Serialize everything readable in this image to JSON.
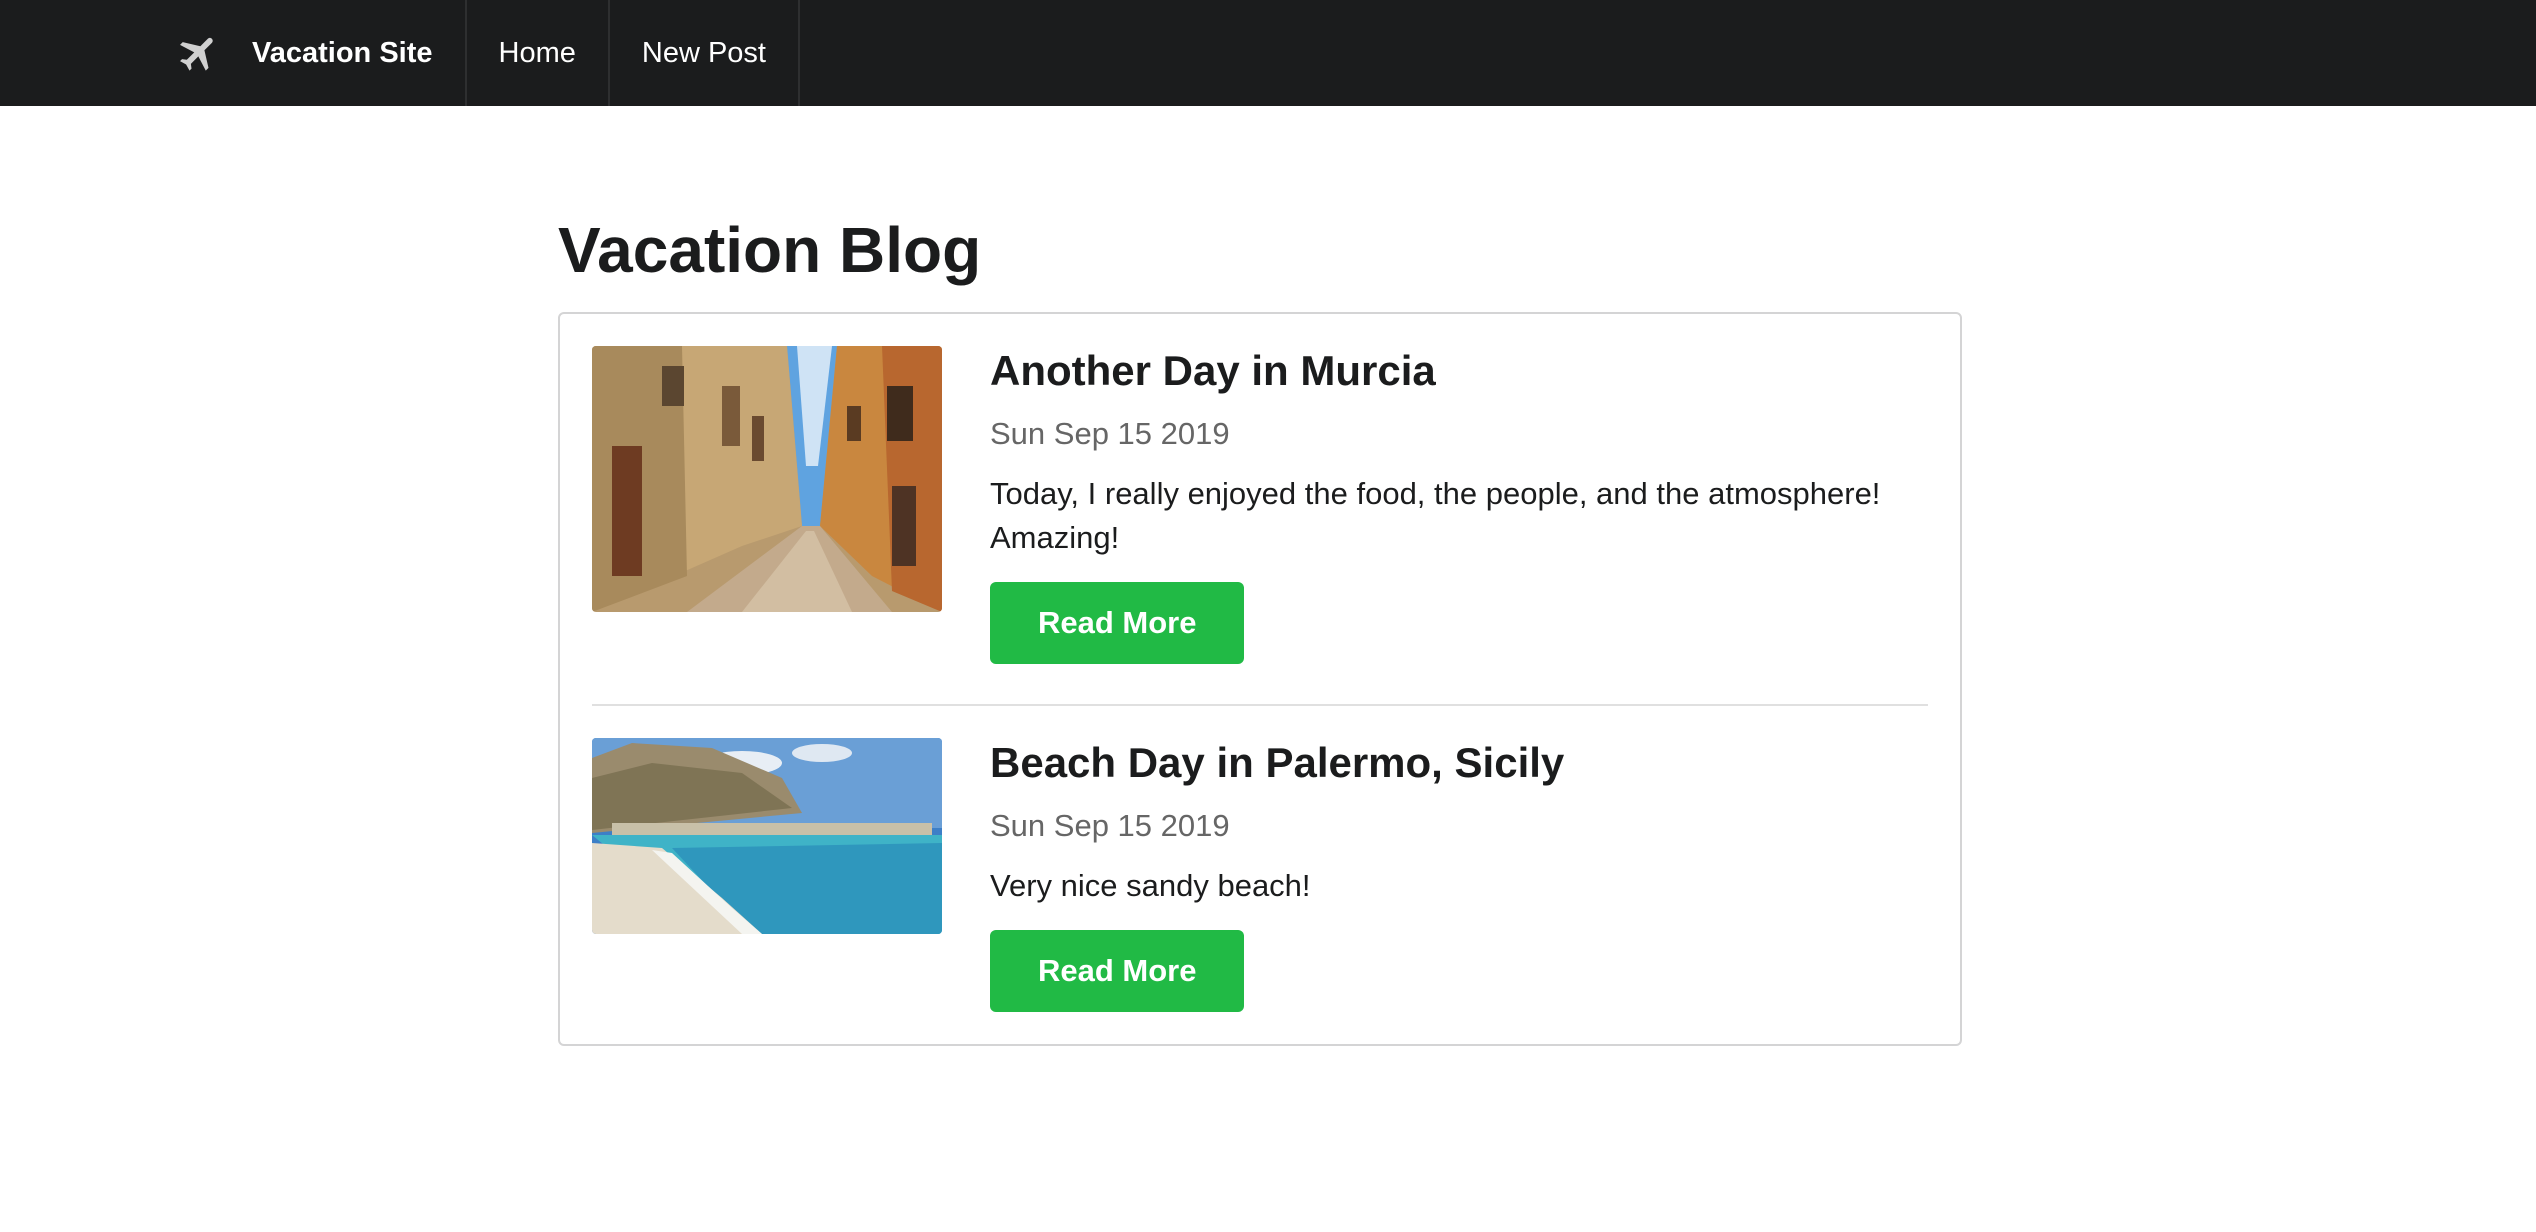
{
  "nav": {
    "brand_icon": "airplane-icon",
    "brand_label": "Vacation Site",
    "items": [
      {
        "label": "Home"
      },
      {
        "label": "New Post"
      }
    ]
  },
  "page": {
    "title": "Vacation Blog"
  },
  "posts": [
    {
      "title": "Another Day in Murcia",
      "date": "Sun Sep 15 2019",
      "text": "Today, I really enjoyed the food, the people, and the atmosphere! Amazing!",
      "button_label": "Read More",
      "image": "narrow-street-photo"
    },
    {
      "title": "Beach Day in Palermo, Sicily",
      "date": "Sun Sep 15 2019",
      "text": "Very nice sandy beach!",
      "button_label": "Read More",
      "image": "beach-photo"
    }
  ],
  "colors": {
    "navbar": "#1b1c1d",
    "button": "#21ba45"
  }
}
